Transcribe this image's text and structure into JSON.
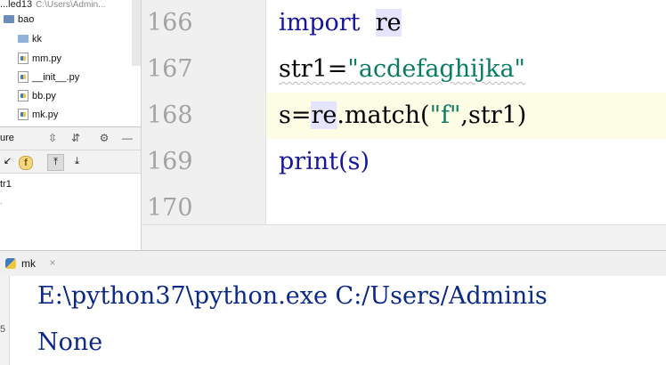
{
  "project": {
    "header_title": "...led13",
    "header_path": "C:\\Users\\Admin...",
    "items": [
      {
        "label": "bao",
        "icon": "folder-icon",
        "indent": 0
      },
      {
        "label": "kk",
        "icon": "folder-icon",
        "indent": 1
      },
      {
        "label": "mm.py",
        "icon": "python-file-icon",
        "indent": 1
      },
      {
        "label": "__init__.py",
        "icon": "python-file-icon",
        "indent": 1
      },
      {
        "label": "bb.py",
        "icon": "python-file-icon",
        "indent": 1
      },
      {
        "label": "mk.py",
        "icon": "python-file-icon",
        "indent": 1
      }
    ]
  },
  "structure": {
    "title": "ure",
    "toolbar_icons": [
      "expand-all-icon",
      "collapse-all-icon",
      "gear-icon",
      "minimize-icon"
    ],
    "sub_icons": [
      "sort-icon",
      "fields-icon",
      "navigate-up-icon",
      "navigate-down-icon"
    ],
    "field_badge": "f",
    "item": "tr1"
  },
  "editor": {
    "line_numbers": [
      "166",
      "167",
      "168",
      "169",
      "170"
    ],
    "lines": {
      "l166_kw": "import",
      "l166_mod": "re",
      "l167_var": "str1=",
      "l167_str": "\"acdefaghijka\"",
      "l168_pre": "s=",
      "l168_re": "re",
      "l168_mid": ".match(",
      "l168_str": "\"f\"",
      "l168_post": ",str1)",
      "l169_fn": "print",
      "l169_rest": "(s)"
    },
    "colors": {
      "keyword": "#16169a",
      "string": "#0a7c64",
      "caret_line": "#fdfce4"
    }
  },
  "run": {
    "tab_label": "mk",
    "close_glyph": "×",
    "side_label": "5",
    "command": "E:\\python37\\python.exe C:/Users/Adminis",
    "output": "None"
  }
}
